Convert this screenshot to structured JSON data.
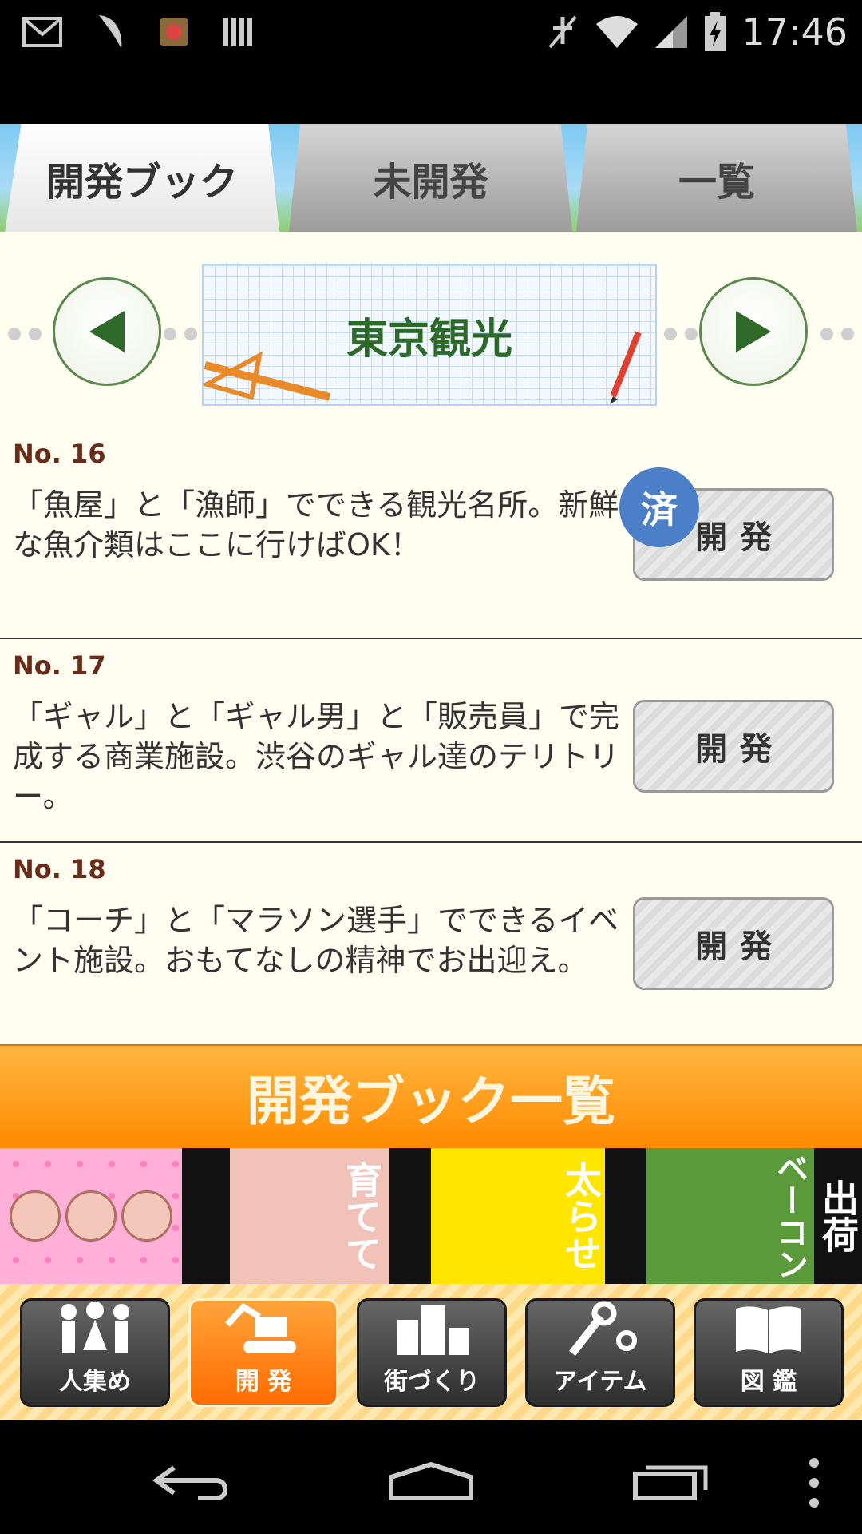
{
  "status_bar": {
    "time": "17:46",
    "left_icons": [
      "gmail-icon",
      "feather-icon",
      "app-icon",
      "barcode-icon"
    ],
    "right_icons": [
      "mute-icon",
      "wifi-icon",
      "signal-icon",
      "battery-charging-icon"
    ]
  },
  "tabs": [
    {
      "label": "開発ブック",
      "active": true
    },
    {
      "label": "未開発",
      "active": false
    },
    {
      "label": "一覧",
      "active": false
    }
  ],
  "category": {
    "title": "東京観光"
  },
  "items": [
    {
      "no": "No. 16",
      "desc": "「魚屋」と「漁師」でできる観光名所。新鮮な魚介類はここに行けばOK！",
      "button": "開発",
      "done_badge": "済"
    },
    {
      "no": "No. 17",
      "desc": "「ギャル」と「ギャル男」と「販売員」で完成する商業施設。渋谷のギャル達のテリトリー。",
      "button": "開発"
    },
    {
      "no": "No. 18",
      "desc": "「コーチ」と「マラソン選手」でできるイベント施設。おもてなしの精神でお出迎え。",
      "button": "開発"
    }
  ],
  "book_list_button": "開発ブック一覧",
  "banner": {
    "texts": [
      "育てて",
      "太らせ",
      "ベーコン",
      "出荷"
    ]
  },
  "bottom_nav": [
    {
      "label": "人集め",
      "icon": "people-icon",
      "active": false
    },
    {
      "label": "開 発",
      "icon": "excavator-icon",
      "active": true
    },
    {
      "label": "街づくり",
      "icon": "buildings-icon",
      "active": false
    },
    {
      "label": "アイテム",
      "icon": "tools-icon",
      "active": false
    },
    {
      "label": "図 鑑",
      "icon": "book-icon",
      "active": false
    }
  ],
  "system_nav": [
    "back-icon",
    "home-icon",
    "recent-apps-icon",
    "menu-icon"
  ],
  "colors": {
    "accent_orange": "#ff8a00",
    "title_green": "#2d6a2a",
    "item_number": "#6a2b1a",
    "done_badge_blue": "#4b7fc8"
  }
}
